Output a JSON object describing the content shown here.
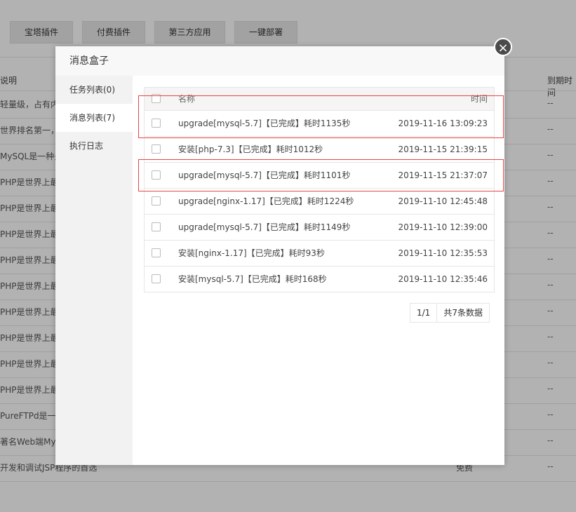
{
  "background": {
    "toolbar_tabs": [
      "宝塔插件",
      "付费插件",
      "第三方应用",
      "一键部署"
    ],
    "columns": {
      "desc": "说明",
      "expire": "到期时间"
    },
    "rows": [
      "轻量级，占有内",
      "世界排名第一，",
      "MySQL是一种关",
      "PHP是世界上最",
      "PHP是世界上最",
      "PHP是世界上最",
      "PHP是世界上最",
      "PHP是世界上最",
      "PHP是世界上最",
      "PHP是世界上最",
      "PHP是世界上最",
      "PHP是世界上最",
      "PureFTPd是一款",
      "著名Web端My",
      "开发和调试JSP程序的首选"
    ],
    "expire_value": "--",
    "free_label": "免费"
  },
  "modal": {
    "title": "消息盒子",
    "close_glyph": "×",
    "sidebar": [
      {
        "label": "任务列表(0)",
        "active": false
      },
      {
        "label": "消息列表(7)",
        "active": true
      },
      {
        "label": "执行日志",
        "active": false
      }
    ],
    "table": {
      "headers": {
        "name": "名称",
        "time": "时间"
      },
      "rows": [
        {
          "name": "upgrade[mysql-5.7]【已完成】耗时1135秒",
          "time": "2019-11-16 13:09:23"
        },
        {
          "name": "安装[php-7.3]【已完成】耗时1012秒",
          "time": "2019-11-15 21:39:15"
        },
        {
          "name": "upgrade[mysql-5.7]【已完成】耗时1101秒",
          "time": "2019-11-15 21:37:07"
        },
        {
          "name": "upgrade[nginx-1.17]【已完成】耗时1224秒",
          "time": "2019-11-10 12:45:48"
        },
        {
          "name": "upgrade[mysql-5.7]【已完成】耗时1149秒",
          "time": "2019-11-10 12:39:00"
        },
        {
          "name": "安装[nginx-1.17]【已完成】耗时93秒",
          "time": "2019-11-10 12:35:53"
        },
        {
          "name": "安装[mysql-5.7]【已完成】耗时168秒",
          "time": "2019-11-10 12:35:46"
        }
      ]
    },
    "pager": {
      "page": "1/1",
      "total": "共7条数据"
    }
  },
  "colors": {
    "highlight": "#e84545",
    "overlay": "rgba(0,0,0,0.3)"
  }
}
